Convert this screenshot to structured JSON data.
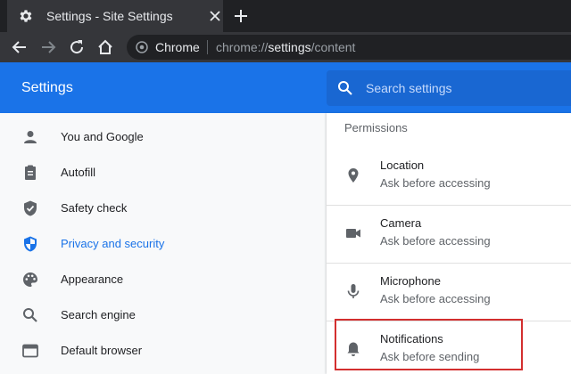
{
  "tab": {
    "title": "Settings - Site Settings"
  },
  "omnibox": {
    "site_label": "Chrome",
    "url_prefix": "chrome://",
    "url_bold": "settings",
    "url_suffix": "/content"
  },
  "header": {
    "title": "Settings"
  },
  "search": {
    "placeholder": "Search settings"
  },
  "sidebar": {
    "items": [
      {
        "label": "You and Google",
        "icon": "person-icon"
      },
      {
        "label": "Autofill",
        "icon": "clipboard-icon"
      },
      {
        "label": "Safety check",
        "icon": "shield-check-icon"
      },
      {
        "label": "Privacy and security",
        "icon": "shield-icon",
        "active": true
      },
      {
        "label": "Appearance",
        "icon": "palette-icon"
      },
      {
        "label": "Search engine",
        "icon": "search-icon"
      },
      {
        "label": "Default browser",
        "icon": "browser-icon"
      }
    ]
  },
  "permissions": {
    "section_title": "Permissions",
    "items": [
      {
        "name": "Location",
        "status": "Ask before accessing",
        "icon": "location-pin-icon"
      },
      {
        "name": "Camera",
        "status": "Ask before accessing",
        "icon": "camera-icon"
      },
      {
        "name": "Microphone",
        "status": "Ask before accessing",
        "icon": "microphone-icon"
      },
      {
        "name": "Notifications",
        "status": "Ask before sending",
        "icon": "bell-icon",
        "highlighted": true
      }
    ]
  },
  "colors": {
    "accent": "#1a73e8",
    "highlight": "#d32f2f",
    "tab_bar": "#202124"
  }
}
